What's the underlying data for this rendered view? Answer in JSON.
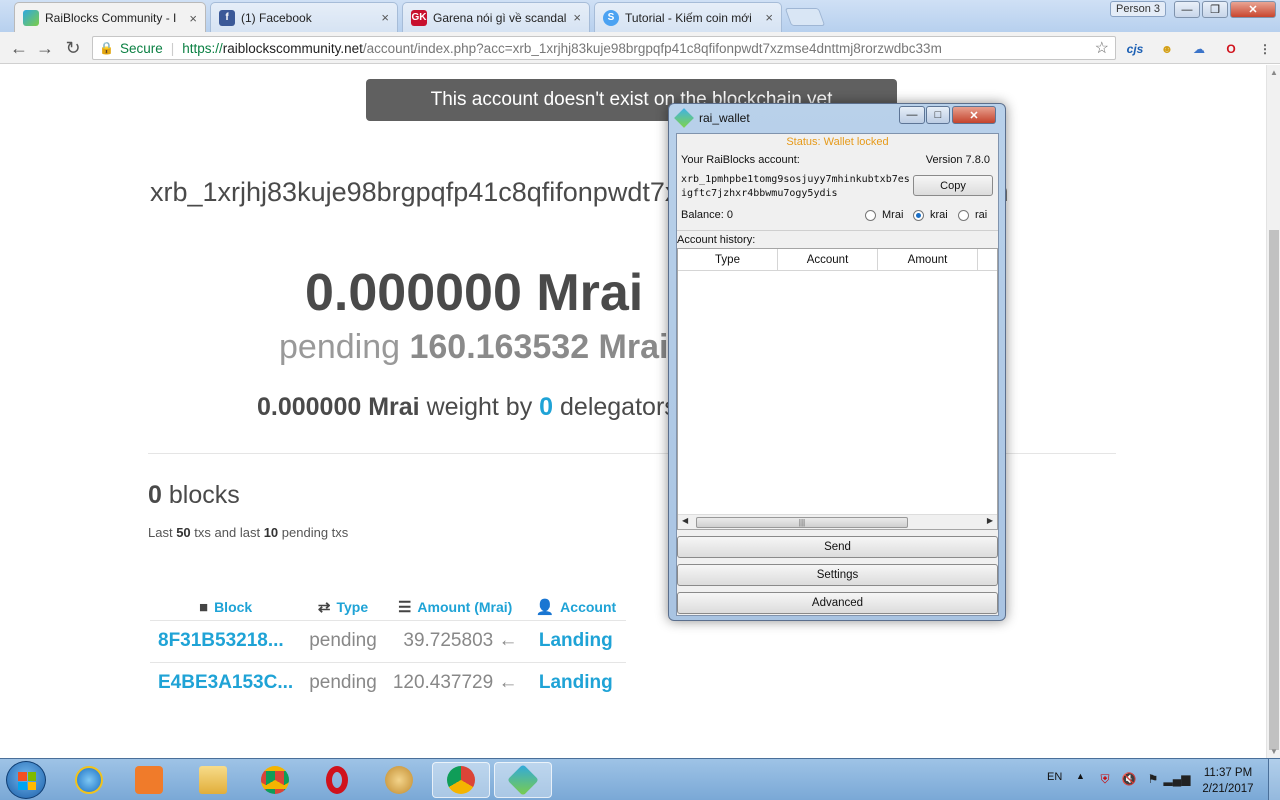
{
  "browser": {
    "tabs": [
      {
        "title": "RaiBlocks Community - I",
        "icon": "raiblocks-icon",
        "active": true
      },
      {
        "title": "(1) Facebook",
        "icon": "facebook-icon",
        "active": false
      },
      {
        "title": "Garena nói gì về scandal",
        "icon": "gk-icon",
        "active": false
      },
      {
        "title": "Tutorial - Kiếm coin mới",
        "icon": "steem-icon",
        "active": false
      }
    ],
    "profile": "Person 3",
    "secure_label": "Secure",
    "url_scheme": "https://",
    "url_host": "raiblockscommunity.net",
    "url_path": "/account/index.php?acc=xrb_1xrjhj83kuje98brgpqfp41c8qfifonpwdt7xzmse4dnttmj8rorzwdbc33m",
    "extensions": [
      "cjs-icon",
      "extension-icon",
      "cloud-icon",
      "opera-icon"
    ]
  },
  "page": {
    "toast": "This account doesn't exist on the blockchain yet",
    "account": "xrb_1xrjhj83kuje98brgpqfp41c8qfifonpwdt7xzmse4dnttmj8rorzwdbc33m",
    "balance": "0.000000 Mrai",
    "pending_label": "pending",
    "pending_value": "160.163532 Mrai",
    "weight_value": "0.000000 Mrai",
    "weight_by": "weight by",
    "weight_count": "0",
    "weight_suffix": "delegators",
    "blocks_count": "0",
    "blocks_label": "blocks",
    "txs_prefix": "Last",
    "txs_count": "50",
    "txs_mid": "txs and last",
    "pending_count": "10",
    "txs_suffix": "pending txs",
    "table": {
      "headers": {
        "block": "Block",
        "type": "Type",
        "amount": "Amount (Mrai)",
        "account": "Account"
      },
      "rows": [
        {
          "block": "8F31B53218...",
          "type": "pending",
          "amount": "39.725803 ←",
          "account": "Landing"
        },
        {
          "block": "E4BE3A153C...",
          "type": "pending",
          "amount": "120.437729 ←",
          "account": "Landing"
        }
      ]
    }
  },
  "wallet": {
    "title": "rai_wallet",
    "status": "Status: Wallet locked",
    "your_account": "Your RaiBlocks account:",
    "version": "Version 7.8.0",
    "address": "xrb_1pmhpbe1tomg9sosjuyy7mhinkubtxb7esigftc7jzhxr4bbwmu7ogy5ydis",
    "copy": "Copy",
    "balance": "Balance: 0",
    "units": [
      {
        "label": "Mrai",
        "selected": false
      },
      {
        "label": "krai",
        "selected": true
      },
      {
        "label": "rai",
        "selected": false
      }
    ],
    "history_label": "Account history:",
    "history_columns": [
      "Type",
      "Account",
      "Amount"
    ],
    "buttons": {
      "send": "Send",
      "settings": "Settings",
      "advanced": "Advanced"
    }
  },
  "taskbar": {
    "items": [
      "ie-icon",
      "media-player-icon",
      "file-explorer-icon",
      "chrome-icon",
      "opera-icon",
      "onion-icon",
      "chrome-profile-icon",
      "rai-wallet-icon"
    ],
    "lang": "EN",
    "time": "11:37 PM",
    "date": "2/21/2017"
  }
}
